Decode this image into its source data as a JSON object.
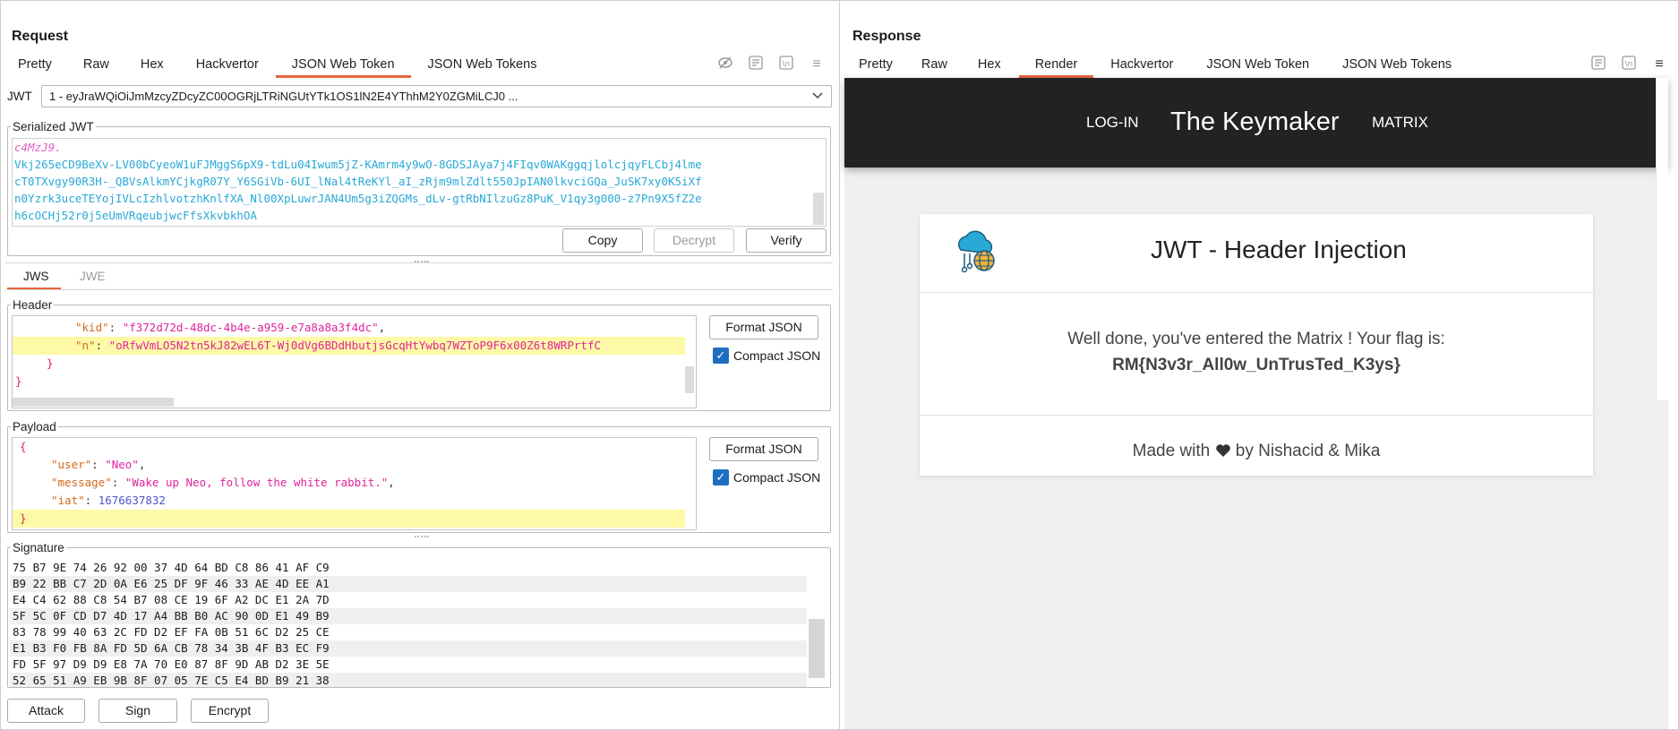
{
  "request": {
    "title": "Request",
    "tabs": [
      "Pretty",
      "Raw",
      "Hex",
      "Hackvertor",
      "JSON Web Token",
      "JSON Web Tokens"
    ],
    "active_tab": "JSON Web Token",
    "jwt_label": "JWT",
    "jwt_select": "1 - eyJraWQiOiJmMzcyZDcyZC00OGRjLTRiNGUtYTk1OS1lN2E4YThhM2Y0ZGMiLCJ0 ...",
    "serialized_legend": "Serialized JWT",
    "serialized_lines": [
      "c4MzJ9.",
      "Vkj265eCD9BeXv-LV00bCyeoW1uFJMggS6pX9-tdLu04Iwum5jZ-KAmrm4y9wO-8GDSJAya7j4FIqv0WAKggqjlolcjqyFLCbj4lme",
      "cT0TXvgy90R3H-_QBVsAlkmYCjkgR07Y_Y6SGiVb-6UI_lNal4tReKYl_aI_zRjm9mlZdlt550JpIAN0lkvciGQa_JuSK7xy0K5iXf",
      "n0Yzrk3uceTEYojIVLcIzhlvotzhKnlfXA_Nl00XpLuwrJAN4Um5g3iZQGMs_dLv-gtRbNIlzuGz8PuK_V1qy3g000-z7Pn9X5fZ2e",
      "h6cOCHj52r0j5eUmVRqeubjwcFfsXkvbkhOA"
    ],
    "copy_label": "Copy",
    "decrypt_label": "Decrypt",
    "verify_label": "Verify",
    "sub_tabs": [
      "JWS",
      "JWE"
    ],
    "header_legend": "Header",
    "header_lines": {
      "kid_key": "\"kid\"",
      "kid_val": "\"f372d72d-48dc-4b4e-a959-e7a8a8a3f4dc\"",
      "n_key": "\"n\"",
      "n_val": "\"oRfwVmLO5N2tn5kJ82wEL6T-Wj0dVg6BDdHbutjsGcqHtYwbq7WZToP9F6x00Z6t8WRPrtfC",
      "close_inner": "}",
      "close_outer": "}"
    },
    "format_json_label": "Format JSON",
    "compact_json_label": "Compact JSON",
    "payload_legend": "Payload",
    "payload_lines": {
      "open": "{",
      "user_key": "\"user\"",
      "user_val": "\"Neo\"",
      "message_key": "\"message\"",
      "message_val": "\"Wake up Neo, follow the white rabbit.\"",
      "iat_key": "\"iat\"",
      "iat_val": "1676637832",
      "close": "}"
    },
    "signature_legend": "Signature",
    "signature_rows": [
      "75 B7 9E 74 26 92 00 37 4D 64 BD C8 86 41 AF C9",
      "B9 22 BB C7 2D 0A E6 25 DF 9F 46 33 AE 4D EE A1",
      "E4 C4 62 88 C8 54 B7 08 CE 19 6F A2 DC E1 2A 7D",
      "5F 5C 0F CD D7 4D 17 A4 BB B0 AC 90 0D E1 49 B9",
      "83 78 99 40 63 2C FD D2 EF FA 0B 51 6C D2 25 CE",
      "E1 B3 F0 FB 8A FD 5D 6A CB 78 34 3B 4F B3 EC F9",
      "FD 5F 97 D9 D9 E8 7A 70 E0 87 8F 9D AB D2 3E 5E",
      "52 65 51 A9 EB 9B 8F 07 05 7E C5 E4 BD B9 21 38"
    ],
    "attack_label": "Attack",
    "sign_label": "Sign",
    "encrypt_label": "Encrypt"
  },
  "response": {
    "title": "Response",
    "tabs": [
      "Pretty",
      "Raw",
      "Hex",
      "Render",
      "Hackvertor",
      "JSON Web Token",
      "JSON Web Tokens"
    ],
    "active_tab": "Render",
    "site": {
      "nav_login": "LOG-IN",
      "nav_brand": "The Keymaker",
      "nav_matrix": "MATRIX",
      "card_title": "JWT - Header Injection",
      "message": "Well done, you've entered the Matrix ! Your flag is:",
      "flag": "RM{N3v3r_All0w_UnTrusTed_K3ys}",
      "footer_made": "Made with",
      "footer_by": "by Nishacid & Mika"
    }
  },
  "colors": {
    "accent": "#e8663d",
    "layout_active": "#1e6ec0",
    "json_key": "#d2691e",
    "json_string": "#e0249c",
    "json_number": "#4f55c8",
    "highlight_line": "#fdf9a6",
    "jwt_signature_text": "#29a9d6",
    "nav_bg": "#222222"
  },
  "icons": [
    "layout-split-icon",
    "layout-horizontal-icon",
    "layout-tabs-icon",
    "eye-slash-icon",
    "wrap-icon",
    "newline-icon",
    "menu-icon",
    "chevron-down-icon",
    "heart-icon",
    "cloud-globe-icon",
    "checkbox-icon"
  ]
}
